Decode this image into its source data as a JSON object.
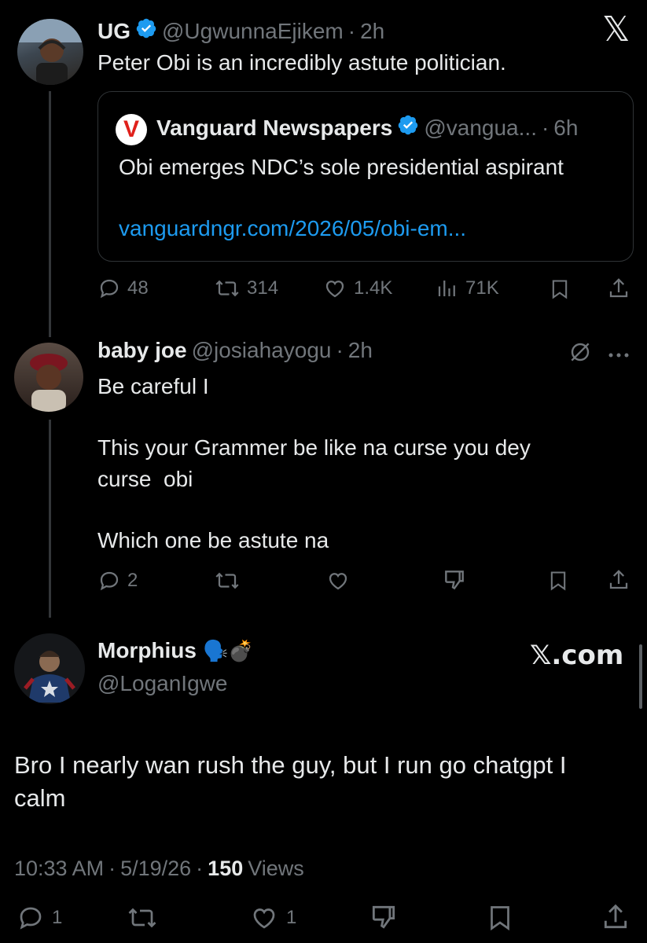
{
  "tweet1": {
    "display_name": "UG",
    "handle": "@UgwunnaEjikem",
    "time": "2h",
    "text": "Peter Obi is an incredibly astute politician.",
    "quote": {
      "name": "Vanguard Newspapers",
      "handle": "@vangua...",
      "time": "6h",
      "text": "Obi emerges NDC’s sole presidential aspirant",
      "link": "vanguardngr.com/2026/05/obi-em...",
      "logo_letter": "V"
    },
    "stats": {
      "replies": "48",
      "reposts": "314",
      "likes": "1.4K",
      "views": "71K"
    }
  },
  "tweet2": {
    "display_name": "baby joe",
    "handle": "@josiahayogu",
    "time": "2h",
    "lines": [
      "Be careful I",
      "This your Grammer be like na curse you dey",
      "curse  obi",
      "Which one be astute na"
    ],
    "stats": {
      "replies": "2"
    }
  },
  "tweet3": {
    "display_name": "Morphius",
    "emoji": "🗣️💣",
    "handle": "@LoganIgwe",
    "brand": "𝕏.com",
    "text_line1": "Bro I nearly wan rush the guy, but I run go chatgpt I",
    "text_line2": "calm",
    "time": "10:33 AM",
    "date": "5/19/26",
    "views_count": "150",
    "views_label": "Views",
    "stats": {
      "replies": "1",
      "likes": "1"
    }
  },
  "top_logo": "𝕏",
  "separator": "·",
  "colors": {
    "background": "#000000",
    "accent": "#1d9bf0",
    "muted": "#71767b",
    "vanguard_red": "#e0201b"
  },
  "icons": [
    "reply-icon",
    "repost-icon",
    "like-icon",
    "views-icon",
    "bookmark-icon",
    "share-icon",
    "dislike-icon",
    "mute-icon",
    "more-icon",
    "verified-icon"
  ]
}
